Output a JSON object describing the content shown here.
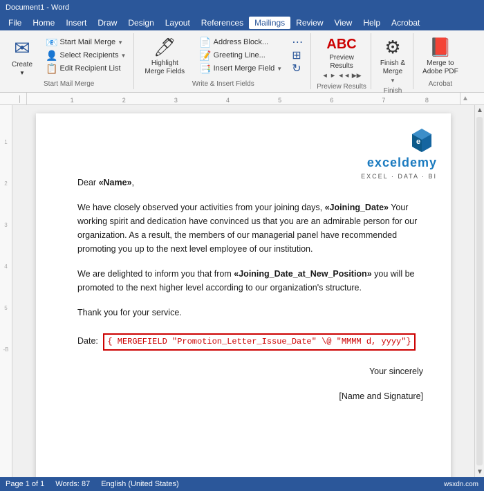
{
  "title": "Document1 - Word",
  "menu": {
    "items": [
      "File",
      "Home",
      "Insert",
      "Draw",
      "Design",
      "Layout",
      "References",
      "Mailings",
      "Review",
      "View",
      "Help",
      "Acrobat"
    ],
    "active": "Mailings"
  },
  "ribbon": {
    "groups": [
      {
        "label": "Start Mail Merge",
        "buttons": [
          {
            "id": "create",
            "label": "Create",
            "icon": "✉",
            "type": "large"
          },
          {
            "id": "start-mail-merge",
            "label": "Start Mail\nMerge",
            "icon": "📧",
            "type": "split"
          },
          {
            "id": "select-recipients",
            "label": "Select\nRecipients",
            "icon": "👥",
            "type": "split"
          },
          {
            "id": "edit-recipient-list",
            "label": "Edit Recipient List",
            "icon": "📋",
            "type": "small"
          }
        ]
      },
      {
        "label": "Write & Insert Fields",
        "buttons": [
          {
            "id": "highlight",
            "label": "Highlight\nMerge Fields",
            "icon": "🖊",
            "type": "large"
          },
          {
            "id": "address-block",
            "label": "Address Block",
            "icon": "📄",
            "type": "small-stacked"
          },
          {
            "id": "greeting-line",
            "label": "Greeting Line",
            "icon": "📝",
            "type": "small-stacked"
          },
          {
            "id": "insert-merge-field",
            "label": "Insert Merge Field",
            "icon": "📑",
            "type": "small-stacked"
          }
        ]
      },
      {
        "label": "Preview Results",
        "buttons": [
          {
            "id": "preview-results",
            "label": "Preview\nResults",
            "icon": "abc",
            "type": "large"
          }
        ]
      },
      {
        "label": "Finish",
        "buttons": [
          {
            "id": "finish-merge",
            "label": "Finish &\nMerge",
            "icon": "⚙",
            "type": "large"
          }
        ]
      },
      {
        "label": "Acrobat",
        "buttons": [
          {
            "id": "merge-to-pdf",
            "label": "Merge to\nAdobe PDF",
            "icon": "📕",
            "type": "large"
          }
        ]
      }
    ]
  },
  "document": {
    "greeting": "Dear",
    "name_field": "«Name»",
    "paragraph1": "We have closely observed your activities from your joining days, ",
    "joining_date_field": "«Joining_Date»",
    "paragraph1_cont": " Your working spirit and dedication have convinced us that you are an admirable person for our organization. As a result, the members of our managerial panel have recommended promoting you up to the next level employee of our institution.",
    "paragraph2_start": "We are delighted to inform you that from ",
    "joining_date_position_field": "«Joining_Date_at_New_Position»",
    "paragraph2_cont": " you will be promoted to the next higher level according to our organization's structure.",
    "thank_you": "Thank you for your service.",
    "date_label": "Date:",
    "date_field": "{ MERGEFIELD \"Promotion_Letter_Issue_Date\" \\@ \"MMMM d, yyyy\"}",
    "closing": "Your sincerely",
    "signature": "[Name and Signature]"
  },
  "logo": {
    "text": "exceldemy",
    "subtext": "EXCEL · DATA · BI"
  },
  "status": {
    "page": "Page 1 of 1",
    "words": "Words: 87",
    "language": "English (United States)"
  }
}
